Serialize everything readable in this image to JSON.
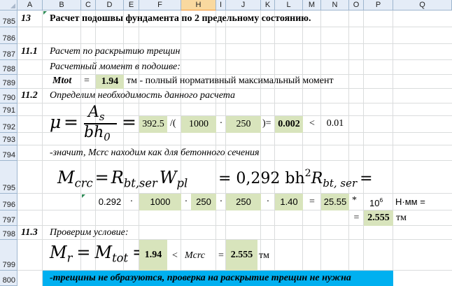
{
  "columns": [
    "A",
    "B",
    "C",
    "D",
    "E",
    "F",
    "H",
    "I",
    "J",
    "K",
    "L",
    "M",
    "N",
    "O",
    "P",
    "Q"
  ],
  "selected_column": "H",
  "rows": [
    "785",
    "786",
    "787",
    "788",
    "789",
    "790",
    "791",
    "792",
    "793",
    "794",
    "795",
    "796",
    "797",
    "798",
    "799",
    "800"
  ],
  "r785": {
    "num": "13",
    "title": "Расчет подошвы фундамента по 2 предельному состоянию."
  },
  "r787": {
    "num": "11.1",
    "text": "Расчет по раскрытию трещин"
  },
  "r788": {
    "text": "Расчетный момент в подошве:"
  },
  "r789": {
    "label": "Mtot",
    "eq": "=",
    "value": "1.94",
    "text": "тм - полный нормативный максимальный момент"
  },
  "r790": {
    "num": "11.2",
    "text": "Определим необходимость данного расчета"
  },
  "r792": {
    "formula_mu": "μ",
    "formula_eq1": "=",
    "formula_num": "A",
    "formula_num_sub": "s",
    "formula_den": "bh",
    "formula_den_sub": "0",
    "formula_eq2": "=",
    "v1": "392.5",
    "op1": "/(",
    "v2": "1000",
    "op2": "·",
    "v3": "250",
    "op3": ")=",
    "result": "0.002",
    "cmp": "<",
    "limit": "0.01"
  },
  "r794": {
    "text": "-значит, Mcrc находим как для бетонного сечения"
  },
  "r795": {
    "M": "M",
    "crc": "crc",
    "eq1": "=",
    "R": "R",
    "btser": "bt,ser",
    "W": "W",
    "pl": "pl",
    "eq2": "= 0,292 bh",
    "sq": "2",
    "R2": "R",
    "btser2": "bt, ser",
    "eq3": "="
  },
  "r796": {
    "c1": "0.292",
    "o1": "·",
    "c2": "1000",
    "o2": "·",
    "c3": "250",
    "o3": "·",
    "c4": "250",
    "o4": "·",
    "c5": "1.40",
    "eq": "=",
    "result": "25.55",
    "star": "*",
    "pow_base": "10",
    "pow_exp": "6",
    "unit": "Н·мм ="
  },
  "r797": {
    "eq": "=",
    "result": "2.555",
    "unit": "тм"
  },
  "r798": {
    "num": "11.3",
    "text": "Проверим условие:"
  },
  "r799": {
    "M": "M",
    "r": "r",
    "eq1": "=",
    "M2": "M",
    "tot": "tot",
    "eq2": "=",
    "v1": "1.94",
    "cmp": "<",
    "mcrc": "Mcrc",
    "eq3": "=",
    "v2": "2.555",
    "unit": "тм"
  },
  "r800": {
    "text": "-трещины не образуются, проверка на раскрытие трещин не нужна"
  },
  "colors": {
    "highlight": "#d8e4bc",
    "banner": "#00b0f0",
    "selected_header": "#f9d99f"
  }
}
